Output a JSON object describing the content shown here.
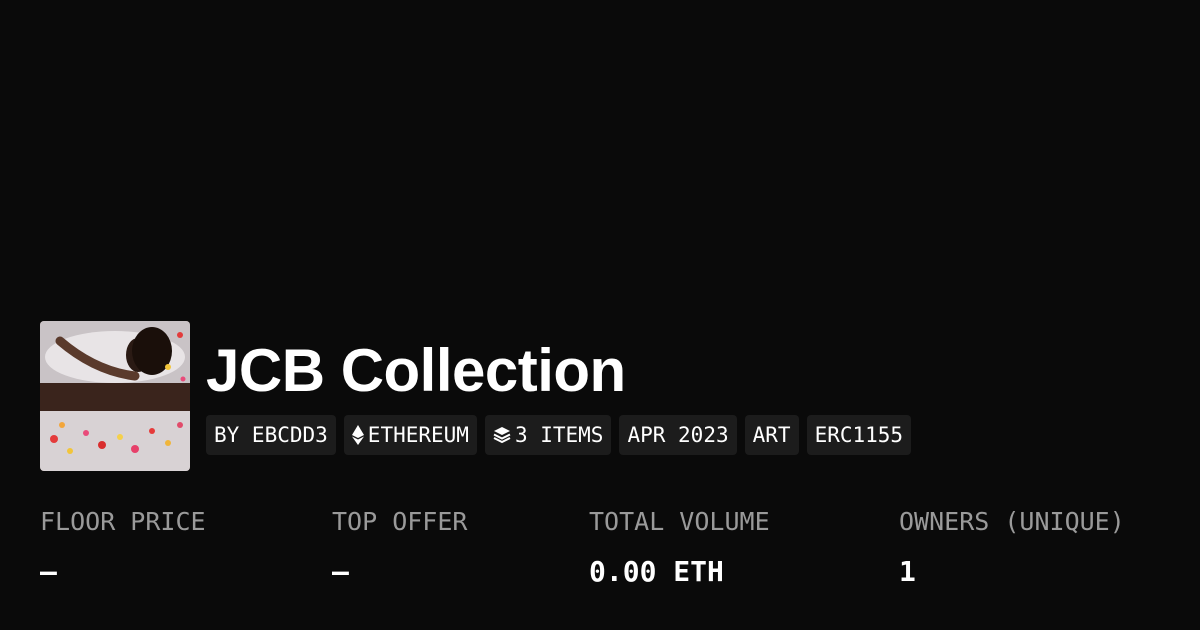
{
  "collection": {
    "title": "JCB Collection",
    "thumbnail_alt": "collection-thumbnail"
  },
  "tags": [
    {
      "label": "BY EBCDD3",
      "icon": ""
    },
    {
      "label": "ETHEREUM",
      "icon": "ethereum-icon"
    },
    {
      "label": "3 ITEMS",
      "icon": "layers-icon"
    },
    {
      "label": "APR 2023",
      "icon": ""
    },
    {
      "label": "ART",
      "icon": ""
    },
    {
      "label": "ERC1155",
      "icon": ""
    }
  ],
  "stats": [
    {
      "label": "FLOOR PRICE",
      "value": "—"
    },
    {
      "label": "TOP OFFER",
      "value": "—"
    },
    {
      "label": "TOTAL VOLUME",
      "value": "0.00 ETH"
    },
    {
      "label": "OWNERS (UNIQUE)",
      "value": "1"
    }
  ],
  "colors": {
    "background": "#0a0a0a",
    "tag_background": "#1c1c1c",
    "label_text": "#9a9a9a",
    "value_text": "#ffffff"
  }
}
